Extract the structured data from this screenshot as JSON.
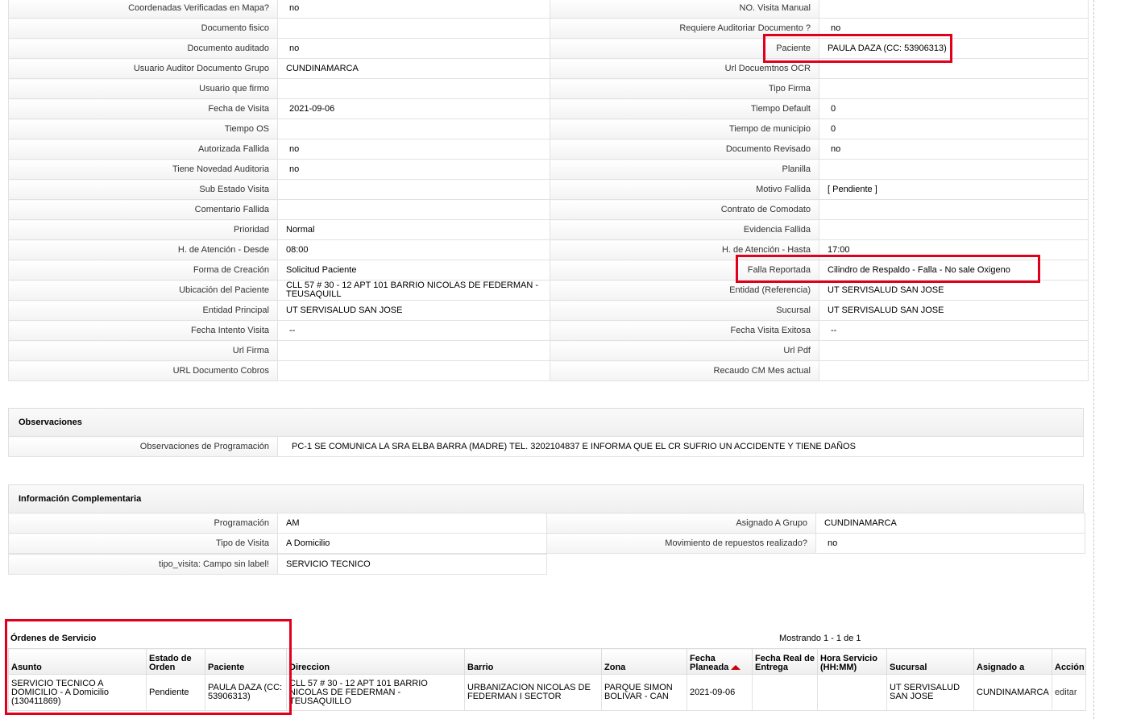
{
  "details": {
    "rows": [
      {
        "l1": "Coordenadas Verificadas en Mapa?",
        "v1": "no",
        "l2": "NO. Visita Manual",
        "v2": ""
      },
      {
        "l1": "Documento fisico",
        "v1": "",
        "l2": "Requiere Auditoriar Documento ?",
        "v2": "no"
      },
      {
        "l1": "Documento auditado",
        "v1": "no",
        "l2": "Paciente",
        "v2": "PAULA DAZA (CC: 53906313)"
      },
      {
        "l1": "Usuario Auditor Documento Grupo",
        "v1": "CUNDINAMARCA",
        "l2": "Url Docuemtnos OCR",
        "v2": ""
      },
      {
        "l1": "Usuario que firmo",
        "v1": "",
        "l2": "Tipo Firma",
        "v2": ""
      },
      {
        "l1": "Fecha de Visita",
        "v1": "2021-09-06",
        "l2": "Tiempo Default",
        "v2": "0"
      },
      {
        "l1": "Tiempo OS",
        "v1": "",
        "l2": "Tiempo de municipio",
        "v2": "0"
      },
      {
        "l1": "Autorizada Fallida",
        "v1": "no",
        "l2": "Documento Revisado",
        "v2": "no"
      },
      {
        "l1": "Tiene Novedad Auditoria",
        "v1": "no",
        "l2": "Planilla",
        "v2": ""
      },
      {
        "l1": "Sub Estado Visita",
        "v1": "",
        "l2": "Motivo Fallida",
        "v2": "[ Pendiente ]"
      },
      {
        "l1": "Comentario Fallida",
        "v1": "",
        "l2": "Contrato de Comodato",
        "v2": ""
      },
      {
        "l1": "Prioridad",
        "v1": "Normal",
        "l2": "Evidencia Fallida",
        "v2": ""
      },
      {
        "l1": "H. de Atención - Desde",
        "v1": "08:00",
        "l2": "H. de Atención - Hasta",
        "v2": "17:00"
      },
      {
        "l1": "Forma de Creación",
        "v1": "Solicitud Paciente",
        "l2": "Falla Reportada",
        "v2": "Cilindro de Respaldo - Falla - No sale Oxigeno"
      },
      {
        "l1": "Ubicación del Paciente",
        "v1": "CLL 57 # 30 - 12 APT 101 BARRIO NICOLAS DE FEDERMAN - TEUSAQUILL",
        "l2": "Entidad (Referencia)",
        "v2": "UT SERVISALUD SAN JOSE"
      },
      {
        "l1": "Entidad Principal",
        "v1": "UT SERVISALUD SAN JOSE",
        "l2": "Sucursal",
        "v2": "UT SERVISALUD SAN JOSE"
      },
      {
        "l1": "Fecha Intento Visita",
        "v1": "--",
        "l2": "Fecha Visita Exitosa",
        "v2": "--"
      },
      {
        "l1": "Url Firma",
        "v1": "",
        "l2": "Url Pdf",
        "v2": ""
      },
      {
        "l1": "URL Documento Cobros",
        "v1": "",
        "l2": "Recaudo CM Mes actual",
        "v2": ""
      }
    ]
  },
  "observaciones": {
    "title": "Observaciones",
    "label": "Observaciones de Programación",
    "value": "PC-1 SE COMUNICA LA SRA ELBA BARRA (MADRE) TEL. 3202104837 E INFORMA QUE EL CR SUFRIO UN ACCIDENTE Y TIENE DAÑOS"
  },
  "complementaria": {
    "title": "Información Complementaria",
    "rows": [
      {
        "l1": "Programación",
        "v1": "AM",
        "l2": "Asignado A Grupo",
        "v2": "CUNDINAMARCA"
      },
      {
        "l1": "Tipo de Visita",
        "v1": "A Domicilio",
        "l2": "Movimiento de repuestos realizado?",
        "v2": "no"
      }
    ],
    "last": {
      "l1": "tipo_visita: Campo sin label!",
      "v1": "SERVICIO TECNICO"
    }
  },
  "orders": {
    "title": "Órdenes de Servicio",
    "count": "Mostrando 1 - 1 de 1",
    "headers": [
      "Asunto",
      "Estado de Orden",
      "Paciente",
      "Direccion",
      "Barrio",
      "Zona",
      "Fecha Planeada",
      "Fecha Real de Entrega",
      "Hora Servicio (HH:MM)",
      "Sucursal",
      "Asignado a",
      "Acción"
    ],
    "row": {
      "asunto": "SERVICIO TECNICO A DOMICILIO - A Domicilio (130411869)",
      "estado": "Pendiente",
      "paciente": "PAULA DAZA (CC: 53906313)",
      "direccion": "CLL 57 # 30 - 12 APT 101 BARRIO NICOLAS DE FEDERMAN - TEUSAQUILLO",
      "barrio": "URBANIZACION NICOLAS DE FEDERMAN I SECTOR",
      "zona": "PARQUE SIMON BOLIVAR - CAN",
      "fecha_planeada": "2021-09-06",
      "fecha_real": "",
      "hora": "",
      "sucursal": "UT SERVISALUD SAN JOSE",
      "asignado": "CUNDINAMARCA",
      "accion": "editar"
    }
  },
  "colors": {
    "highlight": "#e0001b",
    "sort_arrow": "#cc0000"
  },
  "icons": {
    "sort": "sort-ascending-icon"
  }
}
